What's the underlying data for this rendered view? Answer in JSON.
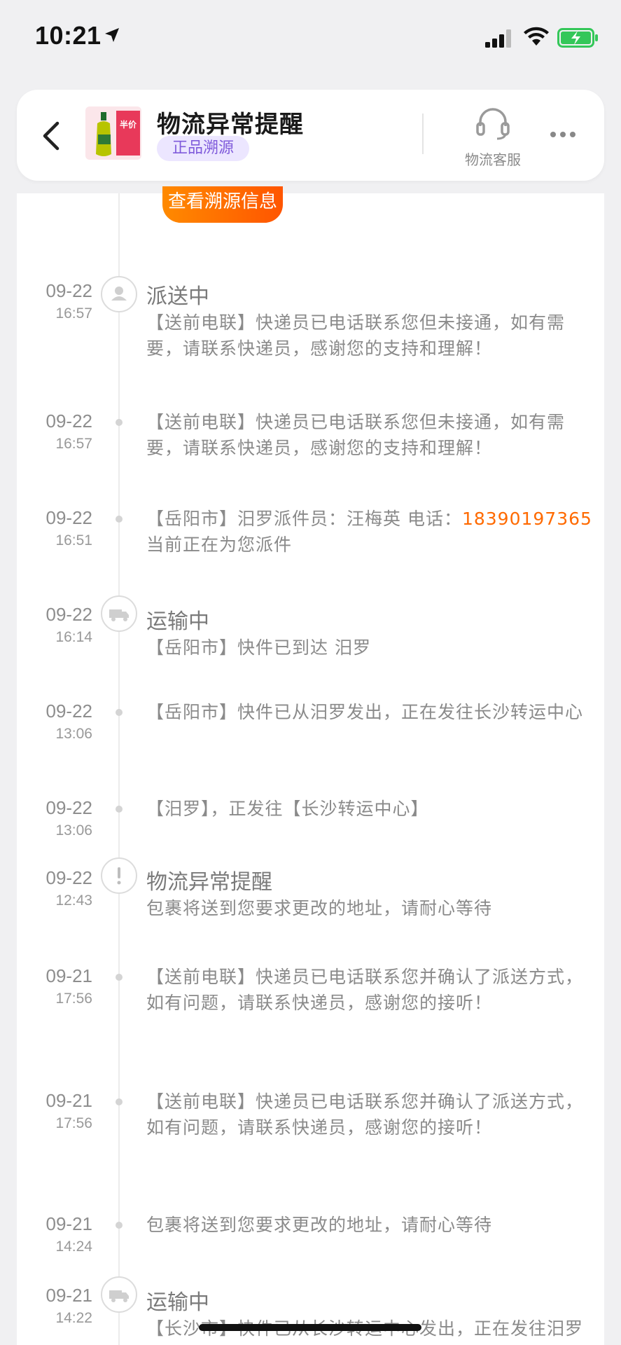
{
  "status_bar": {
    "time": "10:21",
    "icons": [
      "location-arrow-icon",
      "signal-icon",
      "wifi-icon",
      "battery-charging-icon"
    ]
  },
  "header": {
    "title": "物流异常提醒",
    "badge": "正品溯源",
    "customer_service_label": "物流客服",
    "thumb_label": "半价"
  },
  "trace_button": "查看溯源信息",
  "colors": {
    "accent_orange": "#ff6a00",
    "badge_purple": "#7f5bdb",
    "badge_bg": "#ece6ff"
  },
  "events": [
    {
      "date": "09-22",
      "time": "16:57",
      "status": "派送中",
      "icon": "person-icon",
      "text": "【送前电联】快递员已电话联系您但未接通，如有需要，请联系快递员，感谢您的支持和理解！"
    },
    {
      "date": "09-22",
      "time": "16:57",
      "status": "",
      "icon": "",
      "text": "【送前电联】快递员已电话联系您但未接通，如有需要，请联系快递员，感谢您的支持和理解！"
    },
    {
      "date": "09-22",
      "time": "16:51",
      "status": "",
      "icon": "",
      "text_prefix": "【岳阳市】汨罗派件员：汪梅英 电话：",
      "phone": "18390197365",
      "text_suffix": " 当前正在为您派件"
    },
    {
      "date": "09-22",
      "time": "16:14",
      "status": "运输中",
      "icon": "truck-icon",
      "text": "【岳阳市】快件已到达 汨罗"
    },
    {
      "date": "09-22",
      "time": "13:06",
      "status": "",
      "icon": "",
      "text": "【岳阳市】快件已从汨罗发出，正在发往长沙转运中心"
    },
    {
      "date": "09-22",
      "time": "13:06",
      "status": "",
      "icon": "",
      "text": "【汨罗】，正发往【长沙转运中心】"
    },
    {
      "date": "09-22",
      "time": "12:43",
      "status": "物流异常提醒",
      "icon": "exclamation-icon",
      "text": "包裹将送到您要求更改的地址，请耐心等待"
    },
    {
      "date": "09-21",
      "time": "17:56",
      "status": "",
      "icon": "",
      "text": "【送前电联】快递员已电话联系您并确认了派送方式，如有问题，请联系快递员，感谢您的接听！"
    },
    {
      "date": "09-21",
      "time": "17:56",
      "status": "",
      "icon": "",
      "text": "【送前电联】快递员已电话联系您并确认了派送方式，如有问题，请联系快递员，感谢您的接听！"
    },
    {
      "date": "09-21",
      "time": "14:24",
      "status": "",
      "icon": "",
      "text": "包裹将送到您要求更改的地址，请耐心等待"
    },
    {
      "date": "09-21",
      "time": "14:22",
      "status": "运输中",
      "icon": "truck-icon",
      "text": "【长沙市】快件已从长沙转运中心发出，正在发往汨罗"
    }
  ]
}
